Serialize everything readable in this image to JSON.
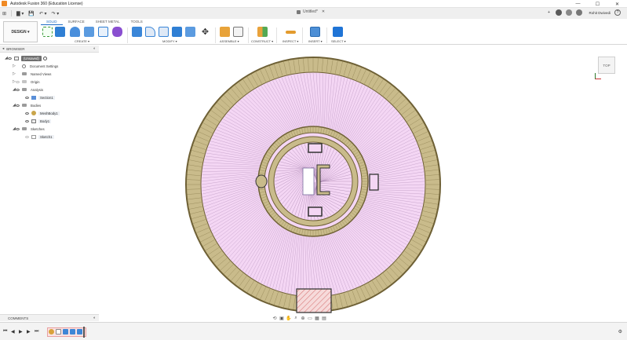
{
  "window": {
    "title": "Autodesk Fusion 360 (Education License)",
    "minimize": "—",
    "maximize": "☐",
    "close": "✕"
  },
  "quick_access": {
    "grid": "⊞",
    "file": "▇ ▾",
    "save": "💾",
    "undo": "↶ ▾",
    "redo": "↷ ▾",
    "document_title": "Untitled*",
    "close_doc": "✕",
    "add": "+",
    "user_name": "Rohit Dwivedi",
    "help": "?"
  },
  "ribbon": {
    "workspace": "DESIGN ▾",
    "tabs": [
      "SOLID",
      "SURFACE",
      "SHEET METAL",
      "TOOLS"
    ],
    "groups": [
      "CREATE ▾",
      "MODIFY ▾",
      "ASSEMBLE ▾",
      "CONSTRUCT ▾",
      "INSPECT ▾",
      "INSERT ▾",
      "SELECT ▾"
    ]
  },
  "browser": {
    "header": "BROWSER",
    "pin": "◐",
    "items": [
      {
        "label": "(Unsaved)",
        "level": 0
      },
      {
        "label": "Document Settings",
        "level": 1
      },
      {
        "label": "Named Views",
        "level": 1
      },
      {
        "label": "Origin",
        "level": 1
      },
      {
        "label": "Analysis",
        "level": 1
      },
      {
        "label": "Section1",
        "level": 2
      },
      {
        "label": "Bodies",
        "level": 1
      },
      {
        "label": "MeshBody1",
        "level": 2
      },
      {
        "label": "Body1",
        "level": 2
      },
      {
        "label": "Sketches",
        "level": 1
      },
      {
        "label": "Sketch1",
        "level": 2
      }
    ]
  },
  "comments": {
    "label": "COMMENTS",
    "pin": "◐"
  },
  "viewcube": {
    "face": "TOP"
  },
  "timeline": {
    "buttons": [
      "⏮",
      "◀",
      "▶",
      "▶",
      "⏭"
    ],
    "settings": "⚙"
  },
  "colors": {
    "ring_fill": "#c9bb8b",
    "ring_edge": "#6e6035",
    "mesh_fill": "#f4d6f4",
    "mesh_line": "#a17da8",
    "section_hatch": "#d97a7a",
    "accent": "#1c6bc5"
  }
}
